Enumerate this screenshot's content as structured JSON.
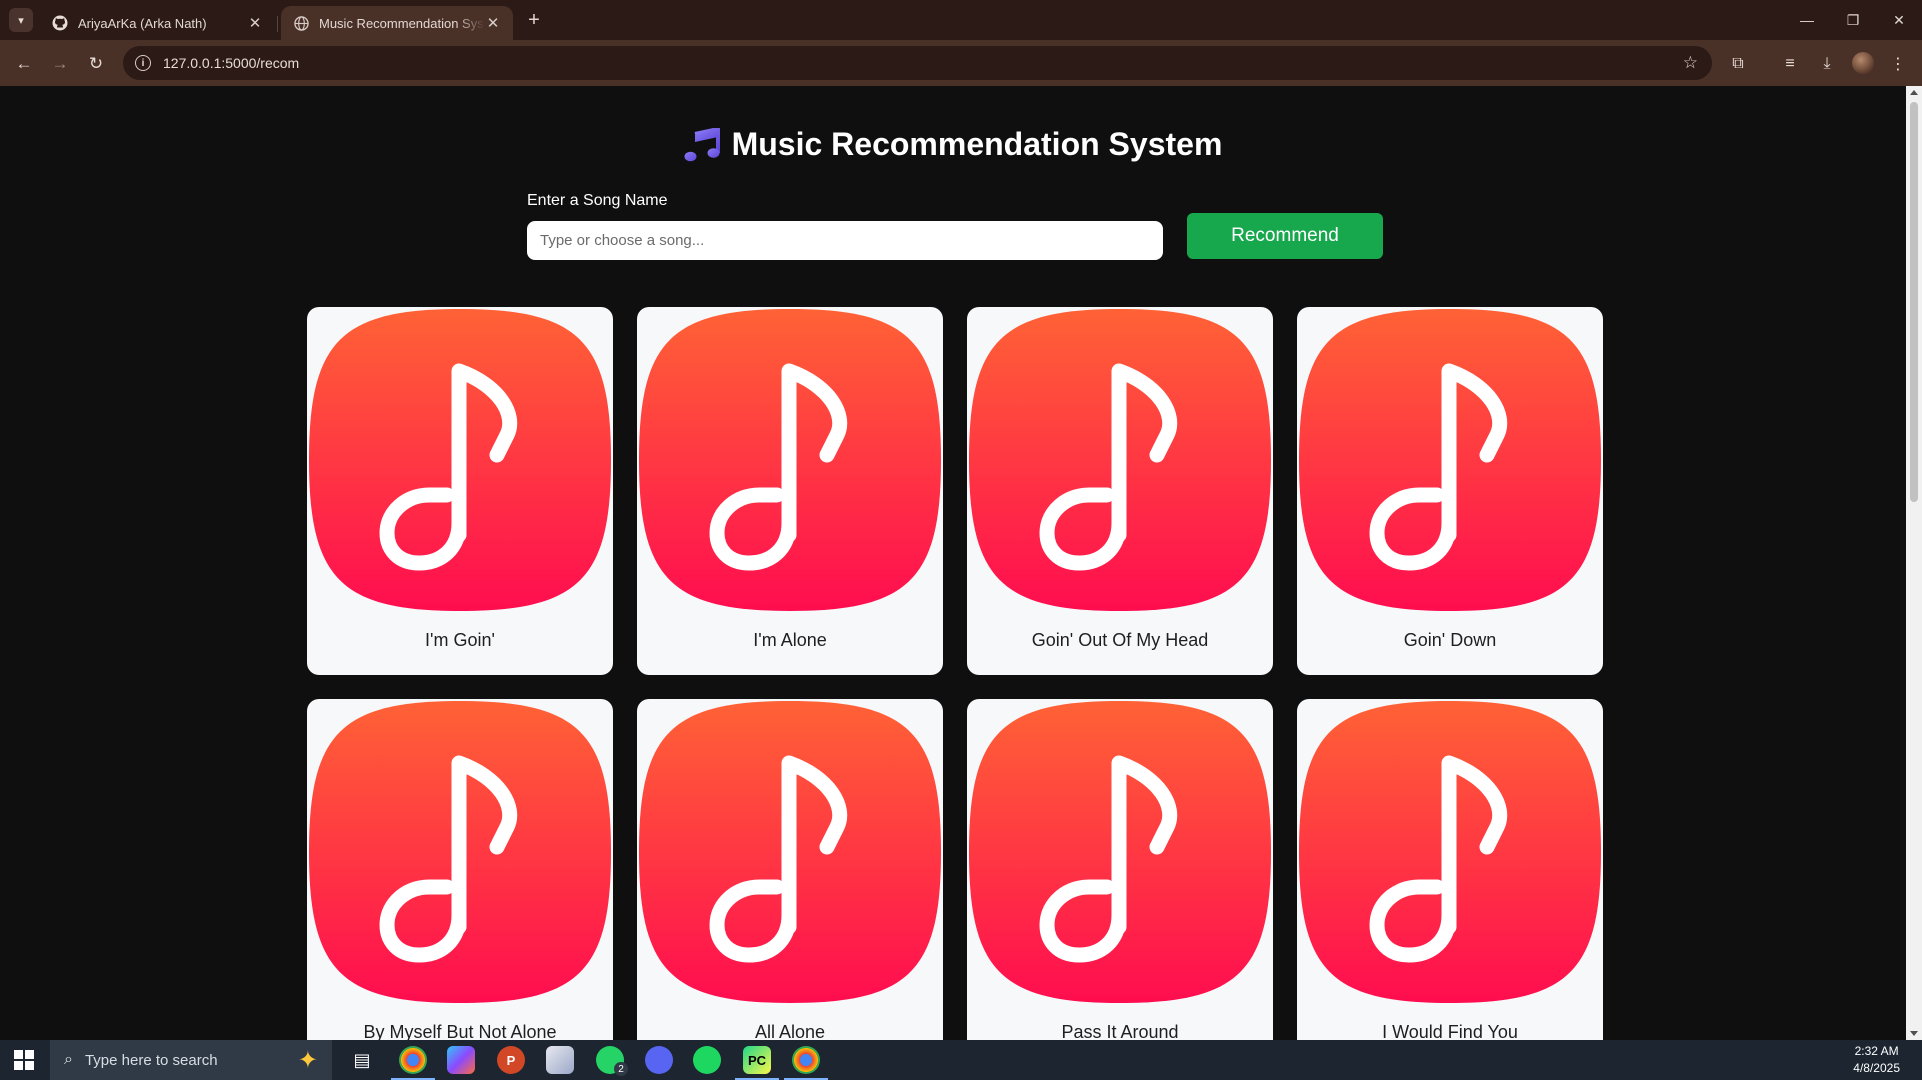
{
  "browser": {
    "tabs": [
      {
        "title": "AriyaArKa (Arka Nath)",
        "icon": "github-icon",
        "active": false
      },
      {
        "title": "Music Recommendation System",
        "icon": "globe-icon",
        "active": true
      }
    ],
    "url": "127.0.0.1:5000/recom"
  },
  "page": {
    "title_icon": "music-note-icon",
    "title": "Music Recommendation System",
    "input_label": "Enter a Song Name",
    "input_placeholder": "Type or choose a song...",
    "input_value": "",
    "button_label": "Recommend",
    "accent_color": "#17a74d",
    "songs": [
      {
        "title": "I'm Goin'"
      },
      {
        "title": "I'm Alone"
      },
      {
        "title": "Goin' Out Of My Head"
      },
      {
        "title": "Goin' Down"
      },
      {
        "title": "By Myself But Not Alone"
      },
      {
        "title": "All Alone"
      },
      {
        "title": "Pass It Around"
      },
      {
        "title": "I Would Find You"
      }
    ]
  },
  "taskbar": {
    "search_placeholder": "Type here to search",
    "whatsapp_badge": "2",
    "powerpoint_letter": "P",
    "pycharm_letters": "PC",
    "time": "2:32 AM",
    "date": "4/8/2025"
  }
}
